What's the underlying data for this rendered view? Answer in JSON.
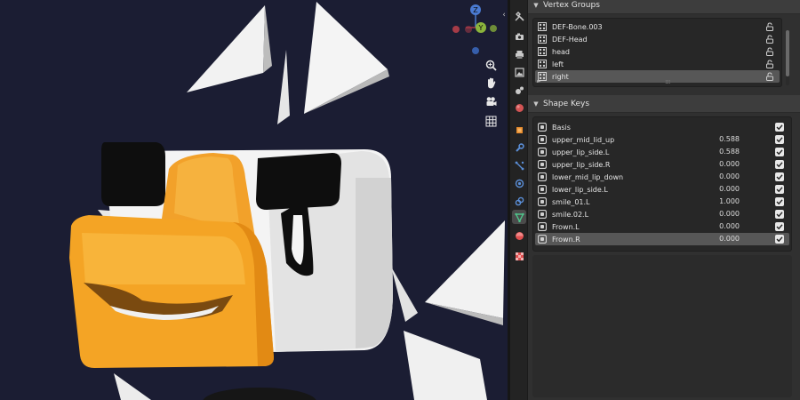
{
  "viewport": {
    "gizmo": {
      "z_label": "Z",
      "y_label": "Y"
    },
    "tools": [
      {
        "name": "zoom-icon",
        "glyph": "🔍"
      },
      {
        "name": "hand-icon",
        "glyph": "✋"
      },
      {
        "name": "camera-icon",
        "glyph": "🎥"
      },
      {
        "name": "grid-icon",
        "glyph": "▦"
      }
    ]
  },
  "properties": {
    "tabs": [
      {
        "name": "tab-tool",
        "icon": "wrench-screwdriver-icon",
        "color": "#c9c9c9"
      },
      {
        "name": "tab-render",
        "icon": "camera-back-icon",
        "color": "#c9c9c9"
      },
      {
        "name": "tab-output",
        "icon": "printer-icon",
        "color": "#c9c9c9"
      },
      {
        "name": "tab-view-layer",
        "icon": "image-icon",
        "color": "#c9c9c9"
      },
      {
        "name": "tab-scene",
        "icon": "scene-icon",
        "color": "#c9c9c9"
      },
      {
        "name": "tab-world",
        "icon": "globe-icon",
        "color": "#d35454"
      },
      {
        "name": "tab-object",
        "icon": "object-cube-icon",
        "color": "#e88c2b"
      },
      {
        "name": "tab-modifiers",
        "icon": "wrench-icon",
        "color": "#5b8fd8"
      },
      {
        "name": "tab-particles",
        "icon": "particles-icon",
        "color": "#5b8fd8"
      },
      {
        "name": "tab-physics",
        "icon": "physics-icon",
        "color": "#5b8fd8"
      },
      {
        "name": "tab-constraints",
        "icon": "constraint-icon",
        "color": "#5b8fd8"
      },
      {
        "name": "tab-data",
        "icon": "mesh-triangle-icon",
        "color": "#4fc38a"
      },
      {
        "name": "tab-material",
        "icon": "material-sphere-icon",
        "color": "#e05050"
      },
      {
        "name": "tab-texture",
        "icon": "checker-texture-icon",
        "color": "#e05050"
      }
    ],
    "vertex_groups": {
      "title": "Vertex Groups",
      "items": [
        {
          "label": "DEF-Bone.003"
        },
        {
          "label": "DEF-Head"
        },
        {
          "label": "head"
        },
        {
          "label": "left"
        },
        {
          "label": "right",
          "selected": true
        }
      ]
    },
    "shape_keys": {
      "title": "Shape Keys",
      "items": [
        {
          "label": "Basis",
          "value": ""
        },
        {
          "label": "upper_mid_lid_up",
          "value": "0.588"
        },
        {
          "label": "upper_lip_side.L",
          "value": "0.588"
        },
        {
          "label": "upper_lip_side.R",
          "value": "0.000"
        },
        {
          "label": "lower_mid_lip_down",
          "value": "0.000"
        },
        {
          "label": "lower_lip_side.L",
          "value": "0.000"
        },
        {
          "label": "smile_01.L",
          "value": "1.000"
        },
        {
          "label": "smile.02.L",
          "value": "0.000"
        },
        {
          "label": "Frown.L",
          "value": "0.000"
        },
        {
          "label": "Frown.R",
          "value": "0.000",
          "selected": true
        }
      ]
    }
  }
}
